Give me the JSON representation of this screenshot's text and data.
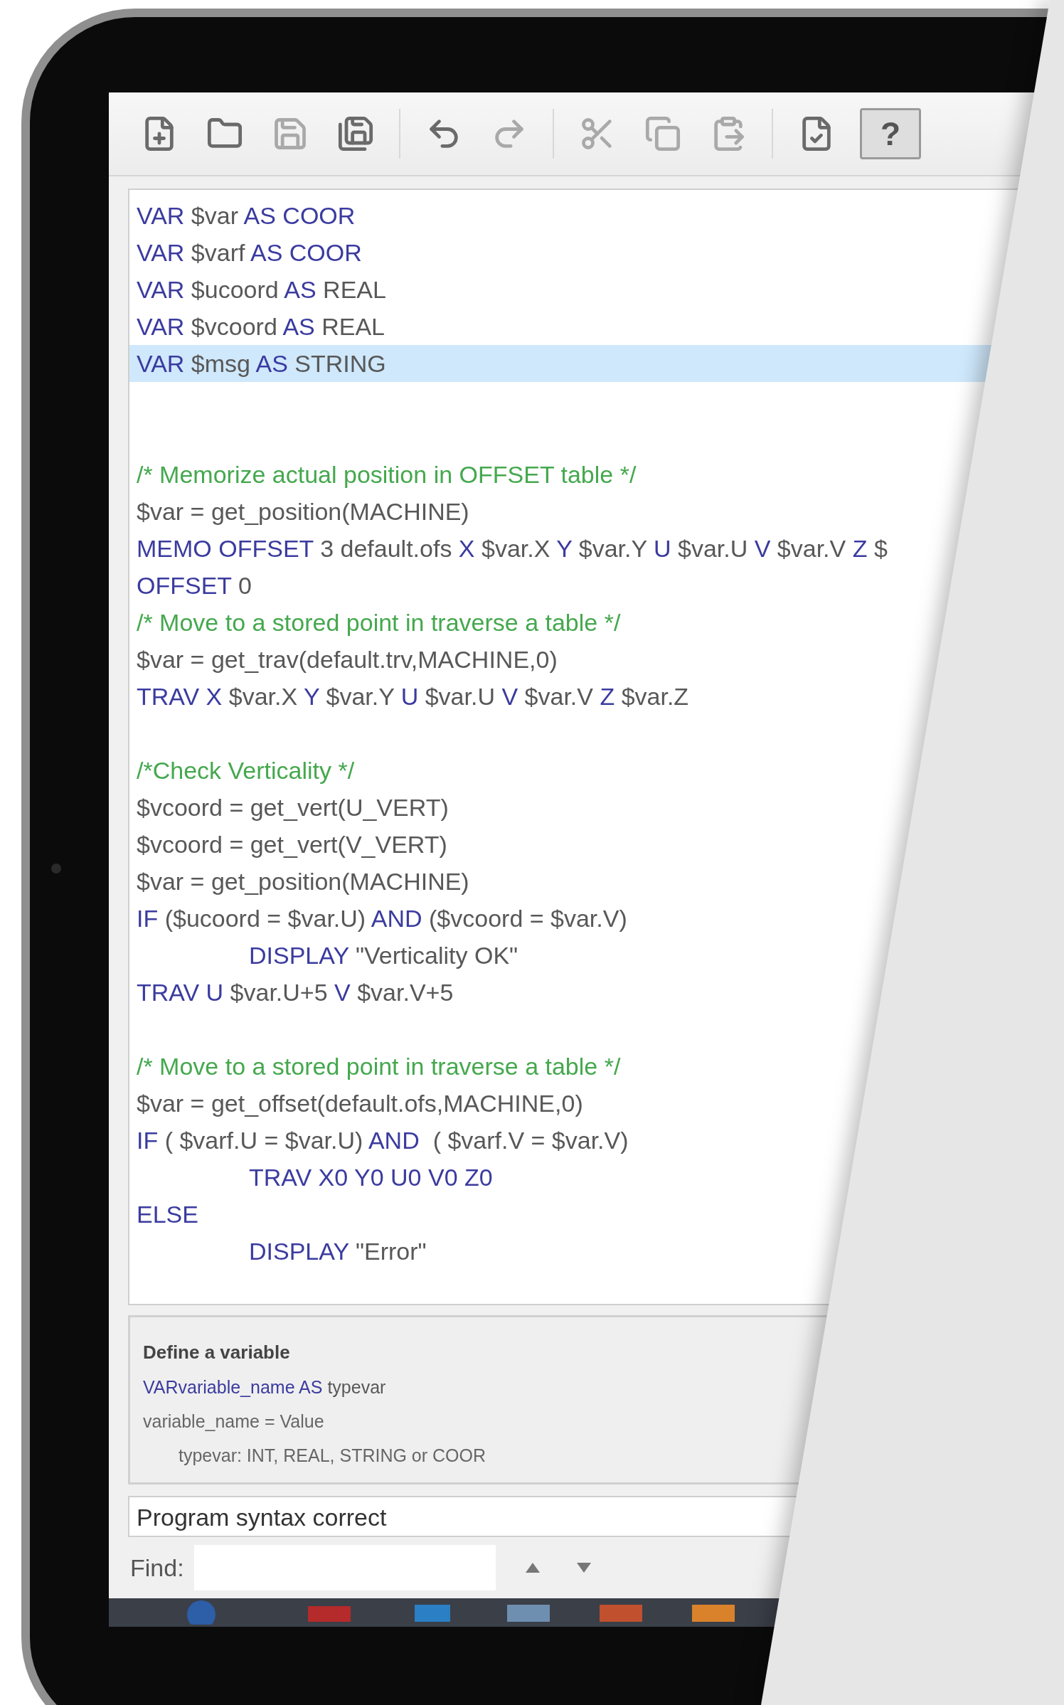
{
  "toolbar": {
    "help_button": {
      "label": "?",
      "pressed": true
    }
  },
  "editor": {
    "lines": [
      {
        "kind": "code",
        "selected": false,
        "indented": false,
        "segments": [
          {
            "kind": "kw",
            "text": "VAR"
          },
          {
            "kind": "text",
            "text": " $var "
          },
          {
            "kind": "kw",
            "text": "AS COOR"
          }
        ]
      },
      {
        "kind": "code",
        "selected": false,
        "indented": false,
        "segments": [
          {
            "kind": "kw",
            "text": "VAR"
          },
          {
            "kind": "text",
            "text": " $varf "
          },
          {
            "kind": "kw",
            "text": "AS COOR"
          }
        ]
      },
      {
        "kind": "code",
        "selected": false,
        "indented": false,
        "segments": [
          {
            "kind": "kw",
            "text": "VAR"
          },
          {
            "kind": "text",
            "text": " $ucoord "
          },
          {
            "kind": "kw",
            "text": "AS"
          },
          {
            "kind": "text",
            "text": " REAL"
          }
        ]
      },
      {
        "kind": "code",
        "selected": false,
        "indented": false,
        "segments": [
          {
            "kind": "kw",
            "text": "VAR"
          },
          {
            "kind": "text",
            "text": " $vcoord "
          },
          {
            "kind": "kw",
            "text": "AS"
          },
          {
            "kind": "text",
            "text": " REAL"
          }
        ]
      },
      {
        "kind": "code",
        "selected": true,
        "indented": false,
        "segments": [
          {
            "kind": "kw",
            "text": "VAR"
          },
          {
            "kind": "text",
            "text": " $msg "
          },
          {
            "kind": "kw",
            "text": "AS"
          },
          {
            "kind": "text",
            "text": " STRING"
          }
        ]
      },
      {
        "kind": "blank",
        "selected": false
      },
      {
        "kind": "blank",
        "selected": false
      },
      {
        "kind": "code",
        "selected": false,
        "indented": false,
        "segments": [
          {
            "kind": "comment",
            "text": "/* Memorize actual position in OFFSET table */"
          }
        ]
      },
      {
        "kind": "code",
        "selected": false,
        "indented": false,
        "segments": [
          {
            "kind": "text",
            "text": "$var = get_position(MACHINE)"
          }
        ]
      },
      {
        "kind": "code",
        "selected": false,
        "indented": false,
        "segments": [
          {
            "kind": "kw",
            "text": "MEMO OFFSET"
          },
          {
            "kind": "text",
            "text": " 3 default.ofs "
          },
          {
            "kind": "kw",
            "text": "X"
          },
          {
            "kind": "text",
            "text": " $var.X "
          },
          {
            "kind": "kw",
            "text": "Y"
          },
          {
            "kind": "text",
            "text": " $var.Y "
          },
          {
            "kind": "kw",
            "text": "U"
          },
          {
            "kind": "text",
            "text": " $var.U "
          },
          {
            "kind": "kw",
            "text": "V"
          },
          {
            "kind": "text",
            "text": " $var.V "
          },
          {
            "kind": "kw",
            "text": "Z"
          },
          {
            "kind": "text",
            "text": " $"
          }
        ]
      },
      {
        "kind": "code",
        "selected": false,
        "indented": false,
        "segments": [
          {
            "kind": "kw",
            "text": "OFFSET"
          },
          {
            "kind": "text",
            "text": " 0"
          }
        ]
      },
      {
        "kind": "code",
        "selected": false,
        "indented": false,
        "segments": [
          {
            "kind": "comment",
            "text": "/* Move to a stored point in traverse a table */"
          }
        ]
      },
      {
        "kind": "code",
        "selected": false,
        "indented": false,
        "segments": [
          {
            "kind": "text",
            "text": "$var = get_trav(default.trv,MACHINE,0)"
          }
        ]
      },
      {
        "kind": "code",
        "selected": false,
        "indented": false,
        "segments": [
          {
            "kind": "kw",
            "text": "TRAV X"
          },
          {
            "kind": "text",
            "text": " $var.X "
          },
          {
            "kind": "kw",
            "text": "Y"
          },
          {
            "kind": "text",
            "text": " $var.Y "
          },
          {
            "kind": "kw",
            "text": "U"
          },
          {
            "kind": "text",
            "text": " $var.U "
          },
          {
            "kind": "kw",
            "text": "V"
          },
          {
            "kind": "text",
            "text": " $var.V "
          },
          {
            "kind": "kw",
            "text": "Z"
          },
          {
            "kind": "text",
            "text": " $var.Z"
          }
        ]
      },
      {
        "kind": "blank",
        "selected": false
      },
      {
        "kind": "code",
        "selected": false,
        "indented": false,
        "segments": [
          {
            "kind": "comment",
            "text": "/*Check Verticality */"
          }
        ]
      },
      {
        "kind": "code",
        "selected": false,
        "indented": false,
        "segments": [
          {
            "kind": "text",
            "text": "$vcoord = get_vert(U_VERT)"
          }
        ]
      },
      {
        "kind": "code",
        "selected": false,
        "indented": false,
        "segments": [
          {
            "kind": "text",
            "text": "$vcoord = get_vert(V_VERT)"
          }
        ]
      },
      {
        "kind": "code",
        "selected": false,
        "indented": false,
        "segments": [
          {
            "kind": "text",
            "text": "$var = get_position(MACHINE)"
          }
        ]
      },
      {
        "kind": "code",
        "selected": false,
        "indented": false,
        "segments": [
          {
            "kind": "kw",
            "text": "IF"
          },
          {
            "kind": "text",
            "text": " ($ucoord = $var.U) "
          },
          {
            "kind": "kw",
            "text": "AND"
          },
          {
            "kind": "text",
            "text": " ($vcoord = $var.V)"
          }
        ]
      },
      {
        "kind": "code",
        "selected": false,
        "indented": true,
        "segments": [
          {
            "kind": "kw",
            "text": "DISPLAY"
          },
          {
            "kind": "text",
            "text": " \"Verticality OK\""
          }
        ]
      },
      {
        "kind": "code",
        "selected": false,
        "indented": false,
        "segments": [
          {
            "kind": "kw",
            "text": "TRAV U"
          },
          {
            "kind": "text",
            "text": " $var.U+5 "
          },
          {
            "kind": "kw",
            "text": "V"
          },
          {
            "kind": "text",
            "text": " $var.V+5"
          }
        ]
      },
      {
        "kind": "blank",
        "selected": false
      },
      {
        "kind": "code",
        "selected": false,
        "indented": false,
        "segments": [
          {
            "kind": "comment",
            "text": "/* Move to a stored point in traverse a table */"
          }
        ]
      },
      {
        "kind": "code",
        "selected": false,
        "indented": false,
        "segments": [
          {
            "kind": "text",
            "text": "$var = get_offset(default.ofs,MACHINE,0)"
          }
        ]
      },
      {
        "kind": "code",
        "selected": false,
        "indented": false,
        "segments": [
          {
            "kind": "kw",
            "text": "IF"
          },
          {
            "kind": "text",
            "text": " ( $varf.U = $var.U) "
          },
          {
            "kind": "kw",
            "text": "AND"
          },
          {
            "kind": "text",
            "text": "  ( $varf.V = $var.V)"
          }
        ]
      },
      {
        "kind": "code",
        "selected": false,
        "indented": true,
        "segments": [
          {
            "kind": "kw",
            "text": "TRAV X0 Y0 U0 V0 Z0"
          }
        ]
      },
      {
        "kind": "code",
        "selected": false,
        "indented": false,
        "segments": [
          {
            "kind": "kw",
            "text": "ELSE"
          }
        ]
      },
      {
        "kind": "code",
        "selected": false,
        "indented": true,
        "segments": [
          {
            "kind": "kw",
            "text": "DISPLAY"
          },
          {
            "kind": "text",
            "text": " \"Error\""
          }
        ]
      }
    ]
  },
  "help": {
    "title": "Define a variable",
    "syntax": [
      {
        "kind": "kw",
        "text": "VARvariable_name AS"
      },
      {
        "kind": "text",
        "text": " typevar"
      }
    ],
    "lines": [
      {
        "text": "variable_name = Value",
        "indented": false
      },
      {
        "text": "typevar: INT, REAL, STRING or COOR",
        "indented": true
      }
    ]
  },
  "status": {
    "message": "Program syntax correct"
  },
  "find": {
    "label": "Find:"
  }
}
